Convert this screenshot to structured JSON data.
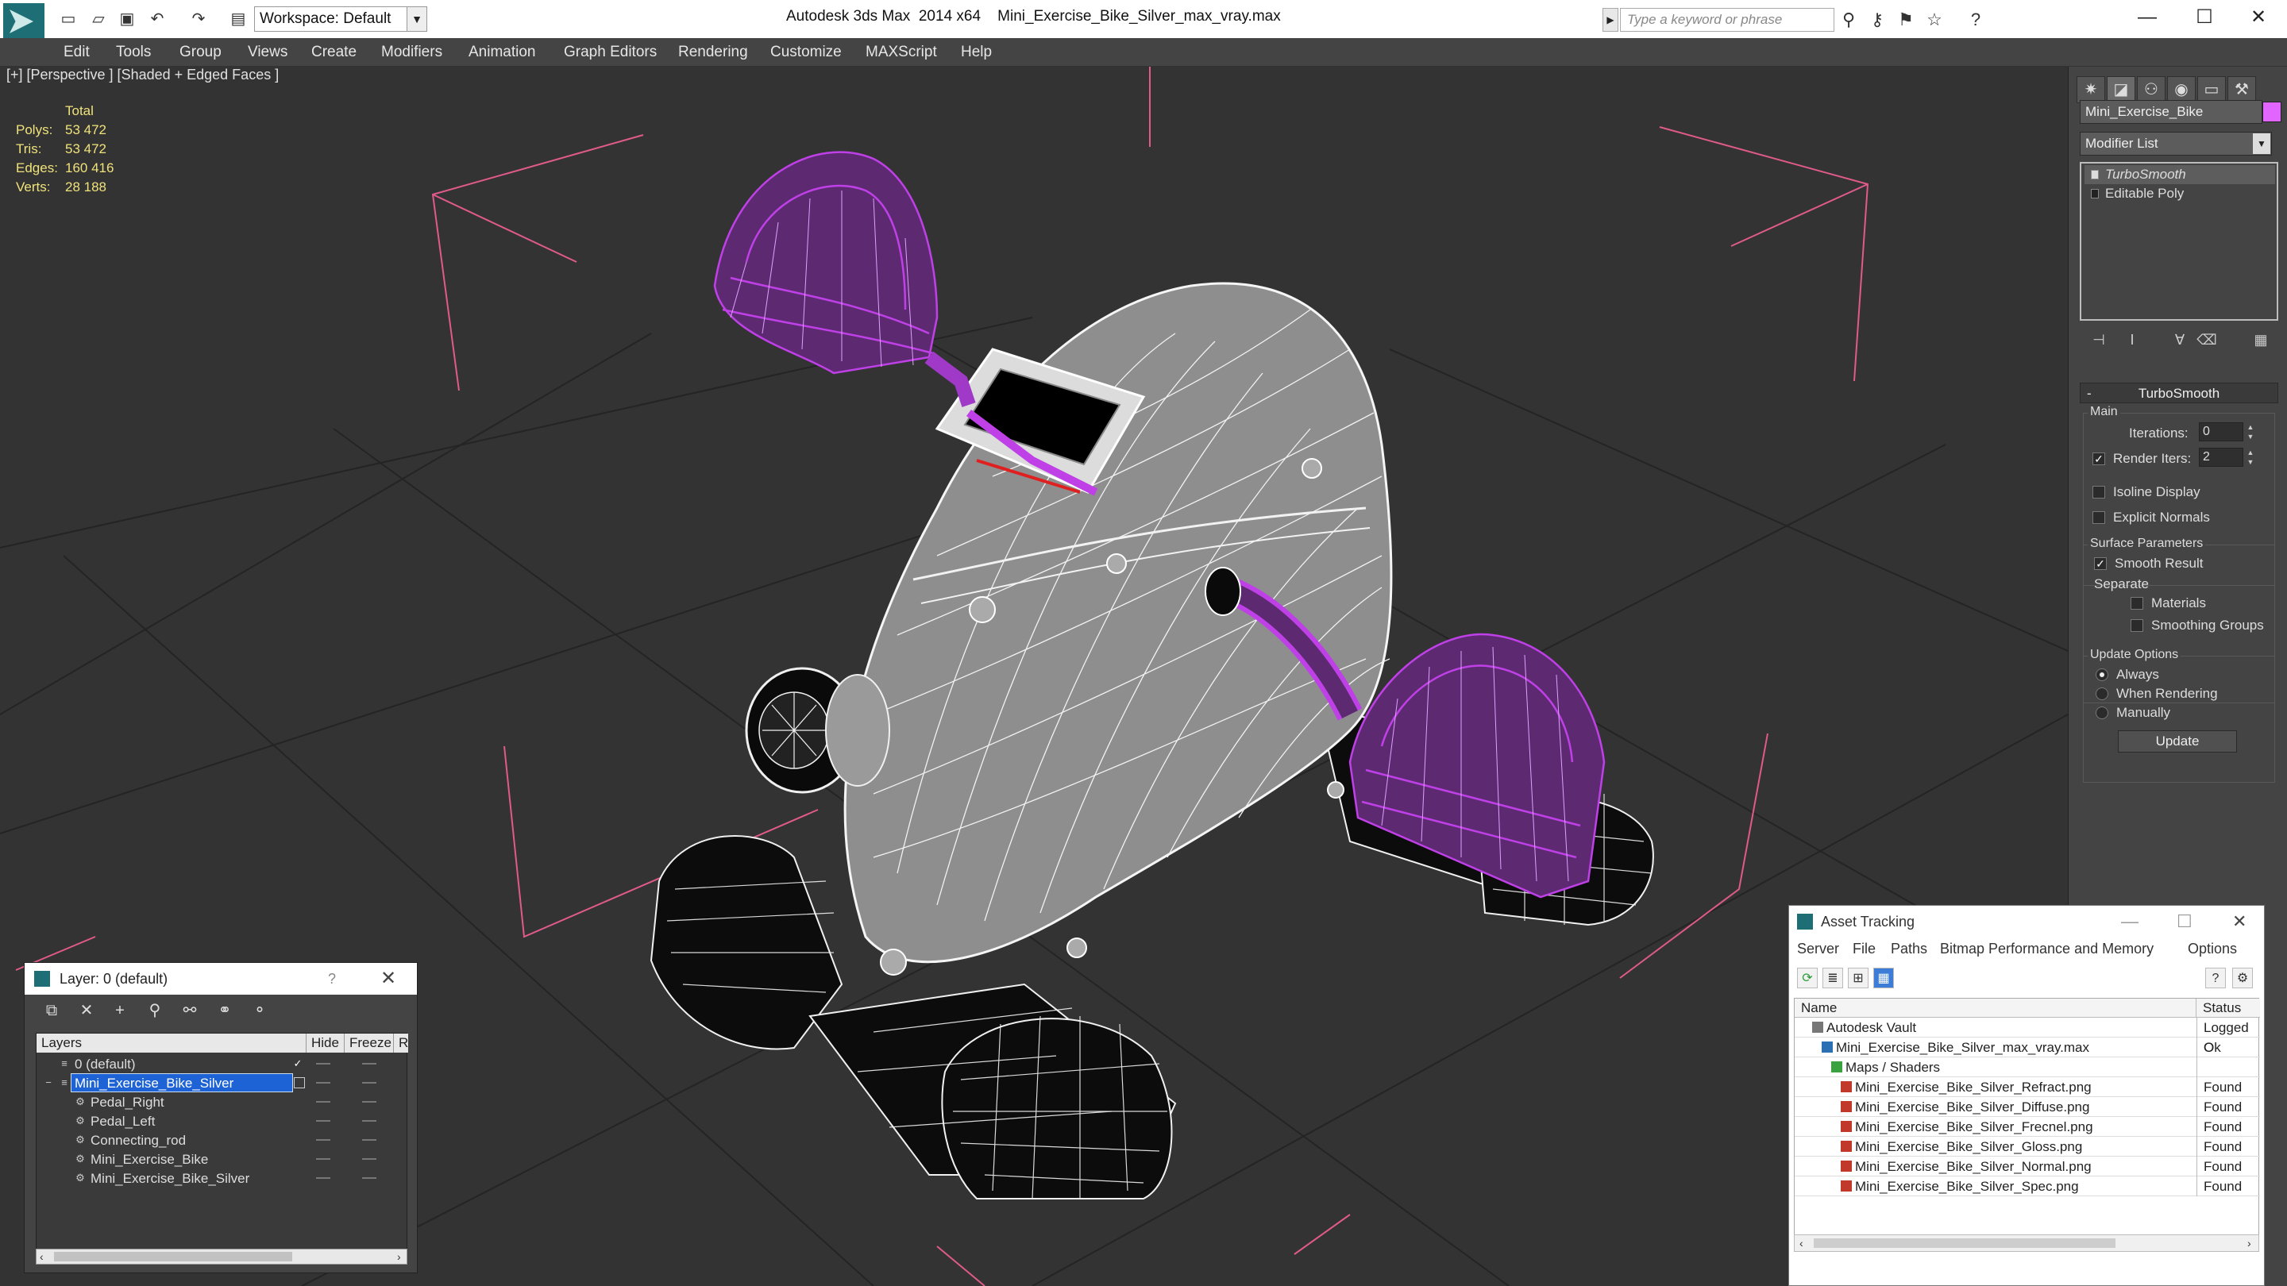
{
  "app": {
    "product": "Autodesk 3ds Max  2014 x64",
    "file": "Mini_Exercise_Bike_Silver_max_vray.max",
    "workspace": "Workspace: Default",
    "search_placeholder": "Type a keyword or phrase"
  },
  "menu": [
    "Edit",
    "Tools",
    "Group",
    "Views",
    "Create",
    "Modifiers",
    "Animation",
    "Graph Editors",
    "Rendering",
    "Customize",
    "MAXScript",
    "Help"
  ],
  "viewport": {
    "label": "[+] [Perspective ] [Shaded + Edged Faces ]",
    "stats": {
      "header": "Total",
      "rows": [
        {
          "k": "Polys:",
          "v": "53 472"
        },
        {
          "k": "Tris:",
          "v": "53 472"
        },
        {
          "k": "Edges:",
          "v": "160 416"
        },
        {
          "k": "Verts:",
          "v": "28 188"
        }
      ]
    },
    "colors": {
      "background": "#333333",
      "selected_wire": "#c040e8",
      "bounds": "#e05a8a",
      "grid": "#222222"
    }
  },
  "command_panel": {
    "object_name": "Mini_Exercise_Bike",
    "object_color": "#e066ff",
    "modifier_list": "Modifier List",
    "stack": [
      "TurboSmooth",
      "Editable Poly"
    ],
    "rollout": {
      "title": "TurboSmooth",
      "main_group": "Main",
      "iterations_label": "Iterations:",
      "iterations_value": "0",
      "render_iters_label": "Render Iters:",
      "render_iters_value": "2",
      "render_iters_checked": true,
      "isoline_display": "Isoline Display",
      "explicit_normals": "Explicit Normals",
      "surface_group": "Surface Parameters",
      "smooth_result": "Smooth Result",
      "separate": "Separate",
      "materials": "Materials",
      "smoothing_groups": "Smoothing Groups",
      "update_group": "Update Options",
      "always": "Always",
      "when_rendering": "When Rendering",
      "manually": "Manually",
      "update_button": "Update"
    }
  },
  "layer_window": {
    "title": "Layer: 0 (default)",
    "columns": [
      "Layers",
      "Hide",
      "Freeze",
      "R"
    ],
    "rows": [
      {
        "name": "0 (default)",
        "level": 0,
        "active": true
      },
      {
        "name": "Mini_Exercise_Bike_Silver",
        "level": 0,
        "selected": true
      },
      {
        "name": "Pedal_Right",
        "level": 1
      },
      {
        "name": "Pedal_Left",
        "level": 1
      },
      {
        "name": "Connecting_rod",
        "level": 1
      },
      {
        "name": "Mini_Exercise_Bike",
        "level": 1
      },
      {
        "name": "Mini_Exercise_Bike_Silver",
        "level": 1
      }
    ]
  },
  "asset_tracking": {
    "title": "Asset Tracking",
    "menu": [
      "Server",
      "File",
      "Paths",
      "Bitmap Performance and Memory",
      "Options"
    ],
    "columns": [
      "Name",
      "Status"
    ],
    "rows": [
      {
        "name": "Autodesk Vault",
        "status": "Logged O",
        "level": 0,
        "icon": "vault"
      },
      {
        "name": "Mini_Exercise_Bike_Silver_max_vray.max",
        "status": "Ok",
        "level": 1,
        "icon": "max"
      },
      {
        "name": "Maps / Shaders",
        "status": "",
        "level": 2,
        "icon": "maps"
      },
      {
        "name": "Mini_Exercise_Bike_Silver_Refract.png",
        "status": "Found",
        "level": 3,
        "icon": "png"
      },
      {
        "name": "Mini_Exercise_Bike_Silver_Diffuse.png",
        "status": "Found",
        "level": 3,
        "icon": "png"
      },
      {
        "name": "Mini_Exercise_Bike_Silver_Frecnel.png",
        "status": "Found",
        "level": 3,
        "icon": "png"
      },
      {
        "name": "Mini_Exercise_Bike_Silver_Gloss.png",
        "status": "Found",
        "level": 3,
        "icon": "png"
      },
      {
        "name": "Mini_Exercise_Bike_Silver_Normal.png",
        "status": "Found",
        "level": 3,
        "icon": "png"
      },
      {
        "name": "Mini_Exercise_Bike_Silver_Spec.png",
        "status": "Found",
        "level": 3,
        "icon": "png"
      }
    ]
  }
}
